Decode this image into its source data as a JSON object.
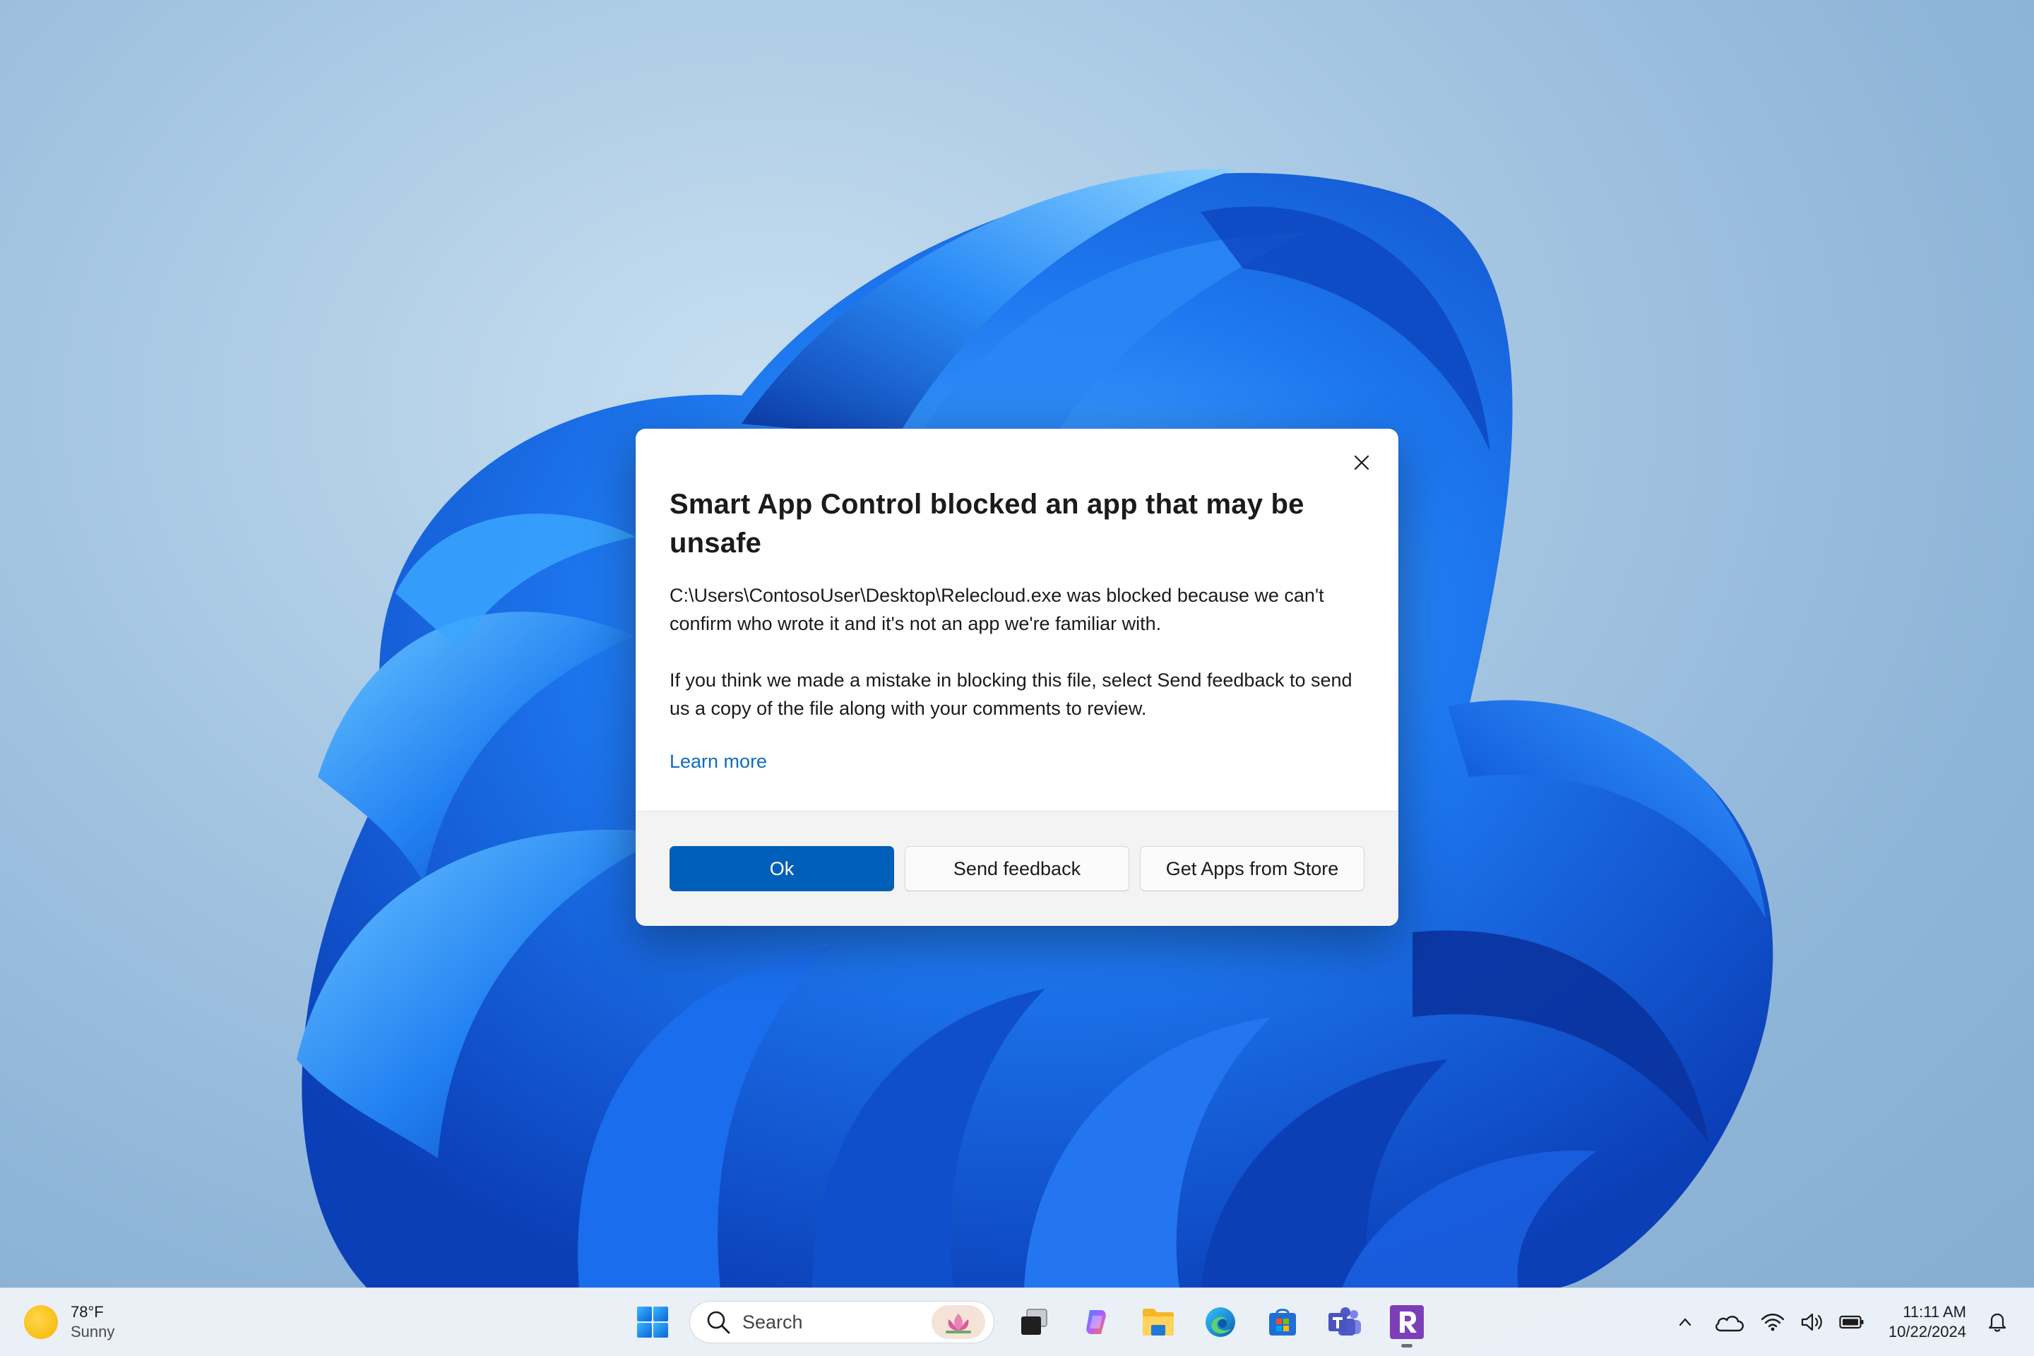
{
  "dialog": {
    "title": "Smart App Control blocked an app that may be unsafe",
    "message": "C:\\Users\\ContosoUser\\Desktop\\Relecloud.exe was blocked because we can't confirm who wrote it and it's not an app we're familiar with.",
    "message2": "If you think we made a mistake in blocking this file, select Send feedback to send us a copy of the file along with your comments to review.",
    "learn_more": "Learn more",
    "buttons": {
      "ok": "Ok",
      "feedback": "Send feedback",
      "store": "Get Apps from Store"
    },
    "close_icon": "close-icon"
  },
  "taskbar": {
    "weather": {
      "temp": "78°F",
      "condition": "Sunny",
      "icon": "sun-icon"
    },
    "search": {
      "label": "Search"
    },
    "apps": [
      "start-icon",
      "task-view-icon",
      "copilot-icon",
      "file-explorer-icon",
      "edge-icon",
      "store-icon",
      "teams-icon",
      "relecloud-icon"
    ],
    "clock": {
      "time": "11:11 AM",
      "date": "10/22/2024"
    },
    "tray": [
      "chevron-up-icon",
      "onedrive-icon",
      "wifi-icon",
      "volume-icon",
      "battery-icon",
      "bell-icon"
    ]
  },
  "colors": {
    "accent": "#005fb8",
    "link": "#0f6cbd",
    "bloom": "#1a66e6"
  }
}
